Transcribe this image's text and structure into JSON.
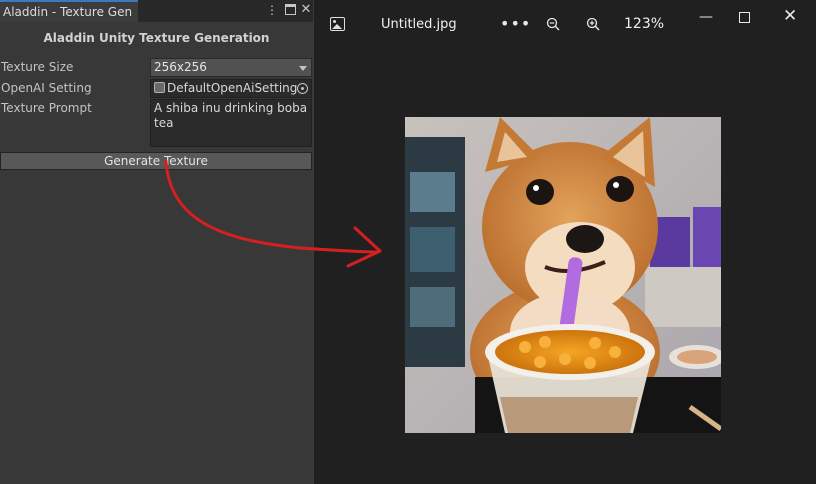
{
  "unity": {
    "tab_title": "Aladdin - Texture Gen",
    "header": "Aladdin Unity Texture Generation",
    "fields": {
      "texture_size_label": "Texture Size",
      "texture_size_value": "256x256",
      "openai_label": "OpenAI Setting",
      "openai_value": "DefaultOpenAiSetting",
      "prompt_label": "Texture Prompt",
      "prompt_value": "A shiba inu drinking boba tea"
    },
    "generate_button": "Generate Texture",
    "icons": [
      "kebab-menu-icon",
      "maximize-icon",
      "close-icon",
      "scriptable-object-icon",
      "object-picker-icon"
    ]
  },
  "viewer": {
    "filename": "Untitled.jpg",
    "more_label": "•••",
    "zoom_level": "123%",
    "min_label": "—",
    "close_label": "✕",
    "icons": [
      "gallery-icon",
      "zoom-out-icon",
      "zoom-in-icon",
      "minimize-icon",
      "maximize-icon",
      "close-icon"
    ]
  },
  "colors": {
    "annotation_arrow": "#d62020",
    "unity_tab_accent": "#3a79bb"
  }
}
